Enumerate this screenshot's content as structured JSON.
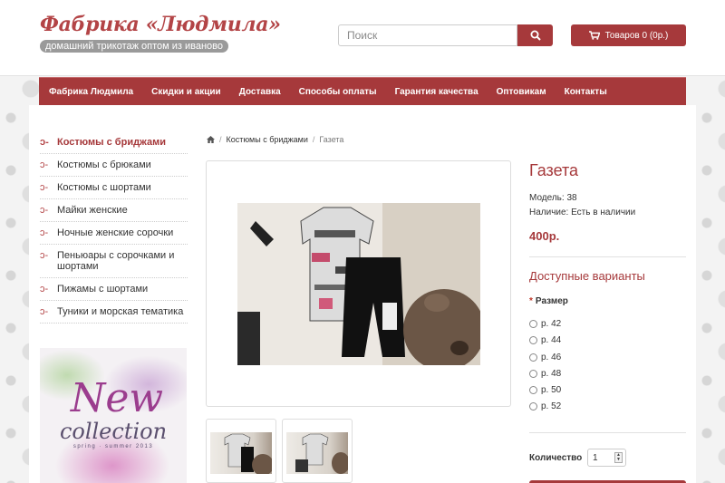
{
  "header": {
    "logo_title": "Фабрика «Людмила»",
    "logo_subtitle": "домашний трикотаж оптом из иваново",
    "search_placeholder": "Поиск",
    "cart_label": "Товаров 0 (0р.)"
  },
  "nav": {
    "items": [
      "Фабрика Людмила",
      "Скидки и акции",
      "Доставка",
      "Способы оплаты",
      "Гарантия качества",
      "Оптовикам",
      "Контакты"
    ]
  },
  "sidebar": {
    "items": [
      {
        "label": "Костюмы с бриджами",
        "active": true
      },
      {
        "label": "Костюмы с брюками"
      },
      {
        "label": "Костюмы с шортами"
      },
      {
        "label": "Майки женские"
      },
      {
        "label": "Ночные женские сорочки"
      },
      {
        "label": "Пеньюары с сорочками и шортами"
      },
      {
        "label": "Пижамы с шортами"
      },
      {
        "label": "Туники и морская тематика"
      }
    ],
    "banner": {
      "line1": "New",
      "line2": "collection",
      "line3": "spring · summer 2013"
    }
  },
  "breadcrumb": {
    "home_icon": "home-icon",
    "category": "Костюмы с бриджами",
    "current": "Газета"
  },
  "product": {
    "title": "Газета",
    "model": "Модель: 38",
    "stock": "Наличие: Есть в наличии",
    "price": "400р.",
    "options_title": "Доступные варианты",
    "size_label": "Размер",
    "sizes": [
      "р. 42",
      "р. 44",
      "р. 46",
      "р. 48",
      "р. 50",
      "р. 52"
    ],
    "qty_label": "Количество",
    "qty_value": "1"
  },
  "colors": {
    "accent": "#a6393b",
    "text": "#333333"
  }
}
